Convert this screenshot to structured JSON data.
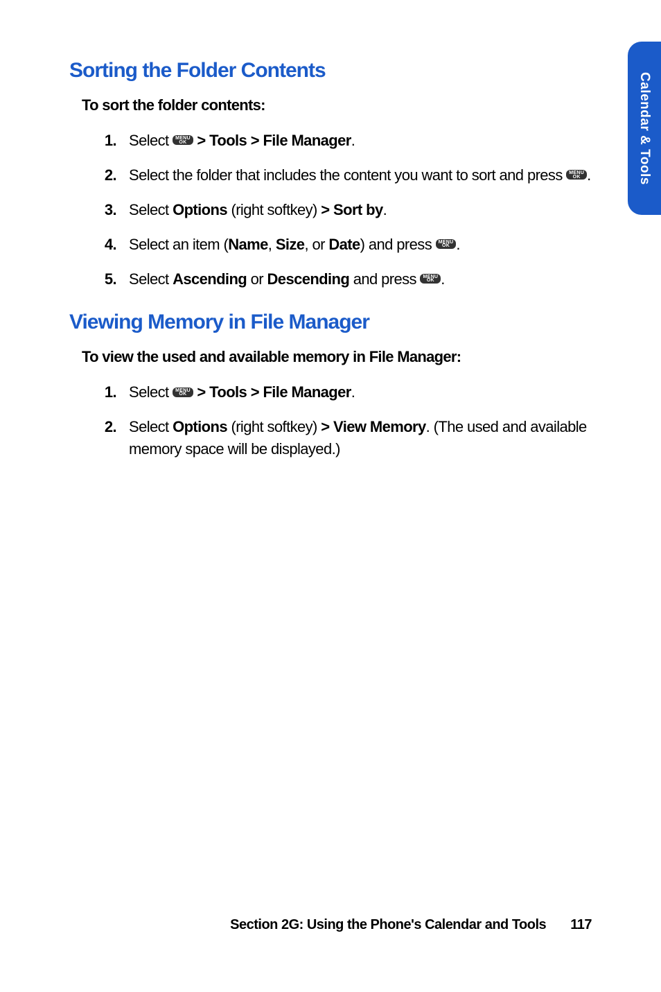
{
  "side_tab": "Calendar & Tools",
  "menu_ok": {
    "top": "MENU",
    "bot": "OK"
  },
  "section1": {
    "heading": "Sorting the Folder Contents",
    "subhead": "To sort the folder contents:",
    "steps": {
      "s1": {
        "pre": "Select ",
        "after": " > Tools > File Manager",
        "period": "."
      },
      "s2": {
        "pre": "Select the folder that includes the content you want to sort and press ",
        "period": "."
      },
      "s3": {
        "t1": "Select ",
        "b1": "Options",
        "t2": " (right softkey) ",
        "b2": "> Sort by",
        "period": "."
      },
      "s4": {
        "t1": "Select an item (",
        "b1": "Name",
        "c1": ", ",
        "b2": "Size",
        "c2": ", or ",
        "b3": "Date",
        "t2": ") and press ",
        "period": "."
      },
      "s5": {
        "t1": "Select ",
        "b1": "Ascending",
        "t2": " or ",
        "b2": "Descending",
        "t3": " and press ",
        "period": "."
      }
    }
  },
  "section2": {
    "heading": "Viewing Memory in File Manager",
    "subhead": "To view the used and available memory in File Manager:",
    "steps": {
      "s1": {
        "pre": "Select ",
        "after": " > Tools > File Manager",
        "period": "."
      },
      "s2": {
        "t1": "Select ",
        "b1": "Options",
        "t2": " (right softkey) ",
        "b2": "> View Memory",
        "t3": ". (The used and available memory space will be displayed.)"
      }
    }
  },
  "footer": {
    "text": "Section 2G: Using the Phone's Calendar and Tools",
    "page": "117"
  }
}
